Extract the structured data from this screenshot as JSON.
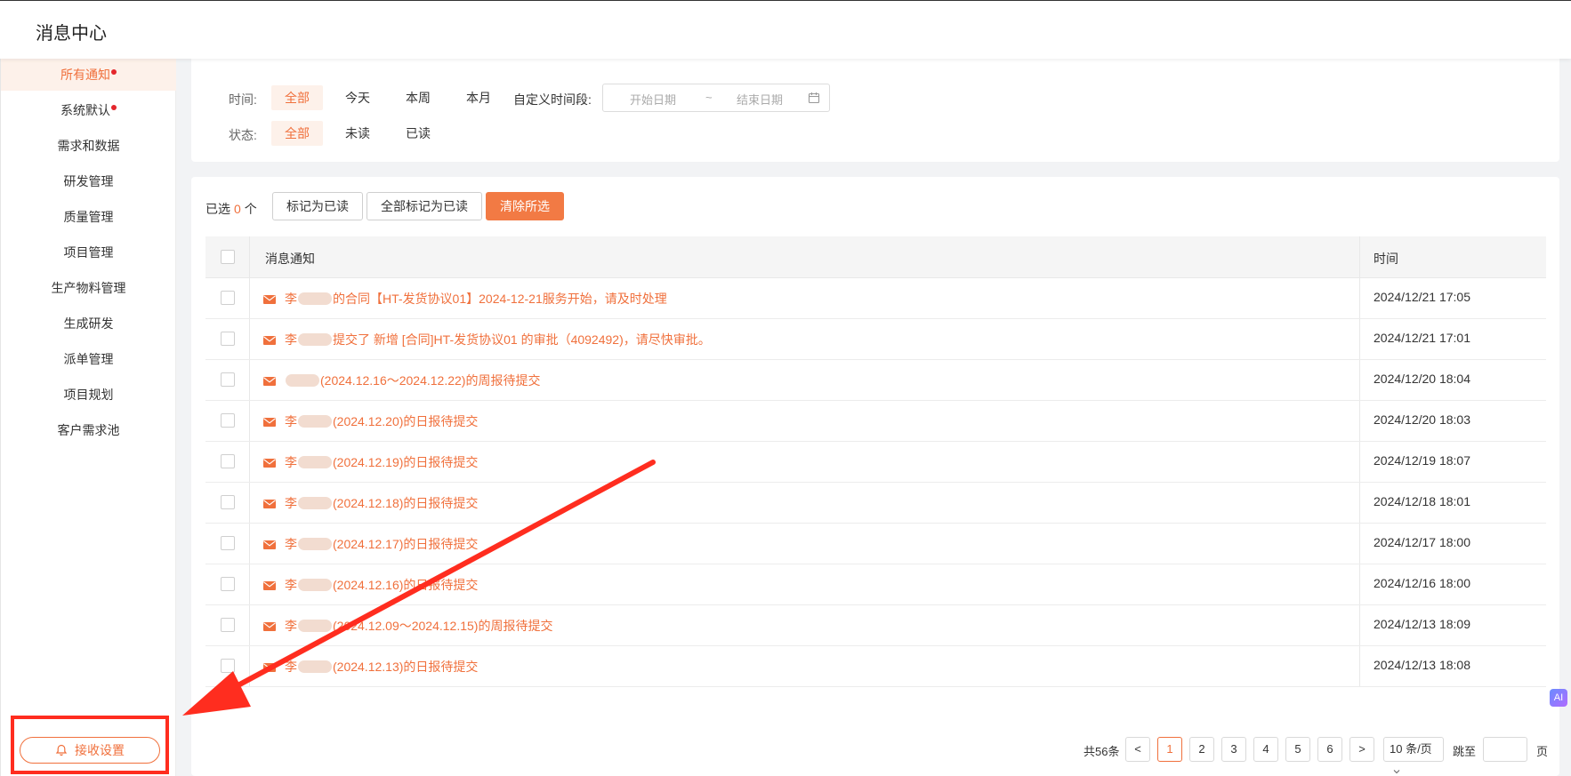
{
  "header": {
    "title": "消息中心"
  },
  "sidebar": {
    "items": [
      {
        "label": "所有通知",
        "active": true,
        "dot": true
      },
      {
        "label": "系统默认",
        "active": false,
        "dot": true
      },
      {
        "label": "需求和数据"
      },
      {
        "label": "研发管理"
      },
      {
        "label": "质量管理"
      },
      {
        "label": "项目管理"
      },
      {
        "label": "生产物料管理"
      },
      {
        "label": "生成研发"
      },
      {
        "label": "派单管理"
      },
      {
        "label": "项目规划"
      },
      {
        "label": "客户需求池"
      }
    ],
    "receive_settings_label": "接收设置"
  },
  "filters": {
    "time_label": "时间:",
    "time_options": [
      "全部",
      "今天",
      "本周",
      "本月"
    ],
    "custom_label": "自定义时间段:",
    "start_placeholder": "开始日期",
    "range_sep": "~",
    "end_placeholder": "结束日期",
    "status_label": "状态:",
    "status_options": [
      "全部",
      "未读",
      "已读"
    ]
  },
  "toolbar": {
    "selected_prefix": "已选",
    "selected_count": "0",
    "selected_suffix": "个",
    "mark_read_label": "标记为已读",
    "mark_all_read_label": "全部标记为已读",
    "clear_selection_label": "清除所选"
  },
  "table": {
    "headers": {
      "message": "消息通知",
      "time": "时间"
    },
    "rows": [
      {
        "pre": "李",
        "text": "的合同【HT-发货协议01】2024-12-21服务开始，请及时处理",
        "time": "2024/12/21 17:05"
      },
      {
        "pre": "李",
        "text": "提交了 新增 [合同]HT-发货协议01 的审批（4092492)，请尽快审批。",
        "time": "2024/12/21 17:01"
      },
      {
        "pre": "",
        "text": "(2024.12.16～2024.12.22)的周报待提交",
        "time": "2024/12/20 18:04"
      },
      {
        "pre": "李",
        "text": "(2024.12.20)的日报待提交",
        "time": "2024/12/20 18:03"
      },
      {
        "pre": "李",
        "text": "(2024.12.19)的日报待提交",
        "time": "2024/12/19 18:07"
      },
      {
        "pre": "李",
        "text": "(2024.12.18)的日报待提交",
        "time": "2024/12/18 18:01"
      },
      {
        "pre": "李",
        "text": "(2024.12.17)的日报待提交",
        "time": "2024/12/17 18:00"
      },
      {
        "pre": "李",
        "text": "(2024.12.16)的日报待提交",
        "time": "2024/12/16 18:00"
      },
      {
        "pre": "李",
        "text": "(2024.12.09～2024.12.15)的周报待提交",
        "time": "2024/12/13 18:09"
      },
      {
        "pre": "李",
        "text": "(2024.12.13)的日报待提交",
        "time": "2024/12/13 18:08"
      }
    ]
  },
  "pagination": {
    "total_label": "共56条",
    "prev": "<",
    "next": ">",
    "pages": [
      "1",
      "2",
      "3",
      "4",
      "5",
      "6"
    ],
    "current": "1",
    "page_size": "10 条/页",
    "jump_label": "跳至",
    "page_suffix": "页"
  },
  "ai_badge": "AI",
  "colors": {
    "accent": "#f0703c",
    "annotation": "#ff2d1f"
  }
}
